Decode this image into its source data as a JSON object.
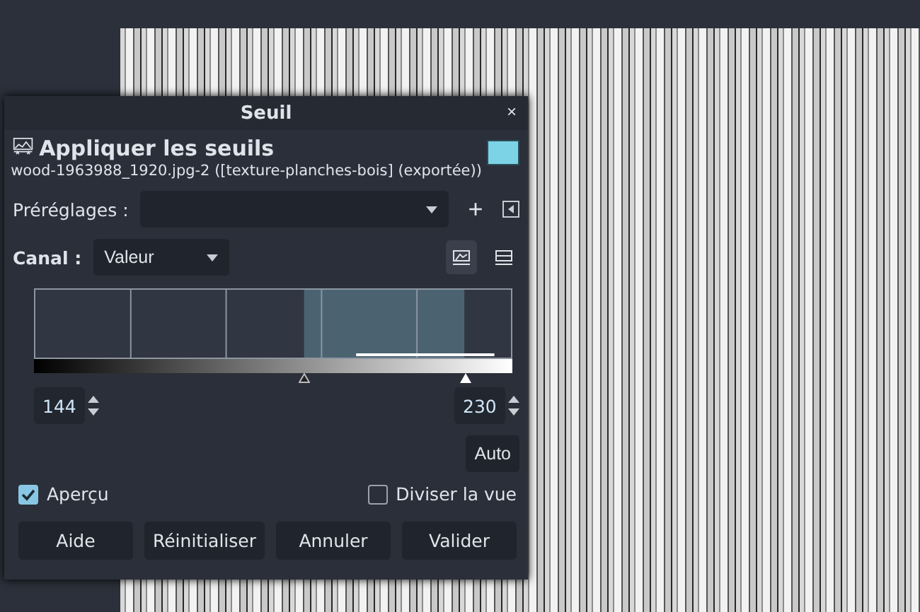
{
  "dialog": {
    "title": "Seuil",
    "close": "×"
  },
  "header": {
    "title": "Appliquer les seuils",
    "subtitle": "wood-1963988_1920.jpg-2 ([texture-planches-bois] (exportée))"
  },
  "presets": {
    "label": "Préréglages :",
    "add": "+"
  },
  "channel": {
    "label": "Canal :",
    "value": "Valeur",
    "linear_selected": true,
    "log_selected": false
  },
  "threshold": {
    "low": {
      "value": "144",
      "level": 0.565
    },
    "high": {
      "value": "230",
      "level": 0.902
    }
  },
  "auto_button": "Auto",
  "preview": {
    "label": "Aperçu",
    "checked": true
  },
  "split_view": {
    "label": "Diviser la vue",
    "checked": false
  },
  "buttons": [
    "Aide",
    "Réinitialiser",
    "Annuler",
    "Valider"
  ]
}
